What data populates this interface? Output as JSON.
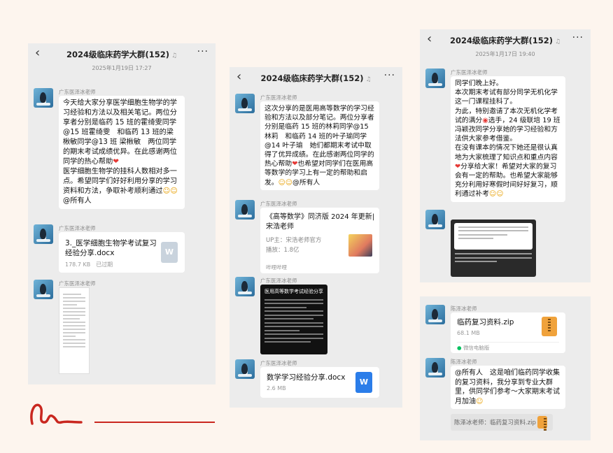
{
  "panel1": {
    "title": "2024级临床药学大群(152)",
    "timestamp": "2025年1月19日 17:27",
    "sender": "广东医泽冰老师",
    "message": "今天给大家分享医学细胞生物学的学习经验和方法以及相关笔记。两位分享者分别是临药 15 班的霍绮雯同学@15 班霍绮雯　和临药 13 班的梁楸敏同学@13 班 梁楸敏　两位同学的期末考试成绩优异。在此感谢两位同学的热心帮助",
    "message2": "医学细胞生物学的挂科人数相对多一点。希望同学们好好利用分享的学习资料和方法，争取补考顺利通过",
    "message_end": "@所有人",
    "file_name": "3._医学细胞生物学考试复习经验分享.docx",
    "file_size": "178.7 KB",
    "file_status": "已过期",
    "file_icon": "W"
  },
  "panel2": {
    "title": "2024级临床药学大群(152)",
    "sender": "广东医泽冰老师",
    "message": "这次分享的是医用高等数学的学习经验和方法以及部分笔记。两位分享者分别是临药 15 班的林莉同学@15 林莉　和临药 14 班的叶子瑜同学@14 叶子瑜　她们都期末考试中取得了优异成绩。在此感谢两位同学的热心帮助",
    "message2": "也希望对同学们在医用高等数学的学习上有一定的帮助和启发。",
    "message_end": "@所有人",
    "link_title": "《高等数学》同济版 2024 年更新|宋浩老师",
    "link_up": "UP主：宋浩老师官方",
    "link_plays": "播放：1.8亿",
    "link_source": "哔哩哔哩",
    "shot_title": "医用高等数学考试经验分享",
    "file_name": "数学学习经验分享.docx",
    "file_size": "2.6 MB",
    "file_icon": "W"
  },
  "panel3": {
    "title": "2024级临床药学大群(152)",
    "timestamp": "2025年1月17日 19:40",
    "sender": "广东医泽冰老师",
    "message": "同学们晚上好。\n本次期末考试有部分同学无机化学这一门课程挂科了。\n为此，特别邀请了本次无机化学考试的满分",
    "message_mid": "选手，24 级联培 19 班冯颖孜同学分享她的学习经验和方法供大家参考借鉴。\n在没有课本的情况下她还是很认真地为大家梳理了知识点和重点内容",
    "message_mid2": "分享给大家！希望对大家的复习会有一定的帮助。也希望大家能够充分利用好寒假时间好好复习，顺利通过补考"
  },
  "panel4": {
    "sender": "陈泽冰老师",
    "file_name": "临药复习资料.zip",
    "file_size": "68.1 MB",
    "file_source": "微信电脑版",
    "message": "@所有人　这是咱们临药同学收集的复习资料，我分享到专业大群里，供同学们参考～大家期末考试月加油",
    "quote": "陈泽冰老师：临药复习资料.zip"
  },
  "icons": {
    "back": "chevron-left-icon",
    "more": "more-dots-icon",
    "mute": "mute-bell-icon",
    "word": "word-file-icon",
    "zip": "zip-file-icon"
  },
  "colors": {
    "word_blue": "#2b7de9",
    "word_gray": "#c9d3dd",
    "zip_orange": "#f0a23b",
    "accent_red": "#c9271f",
    "heart": "#e53935",
    "wechat_green": "#07c160"
  }
}
